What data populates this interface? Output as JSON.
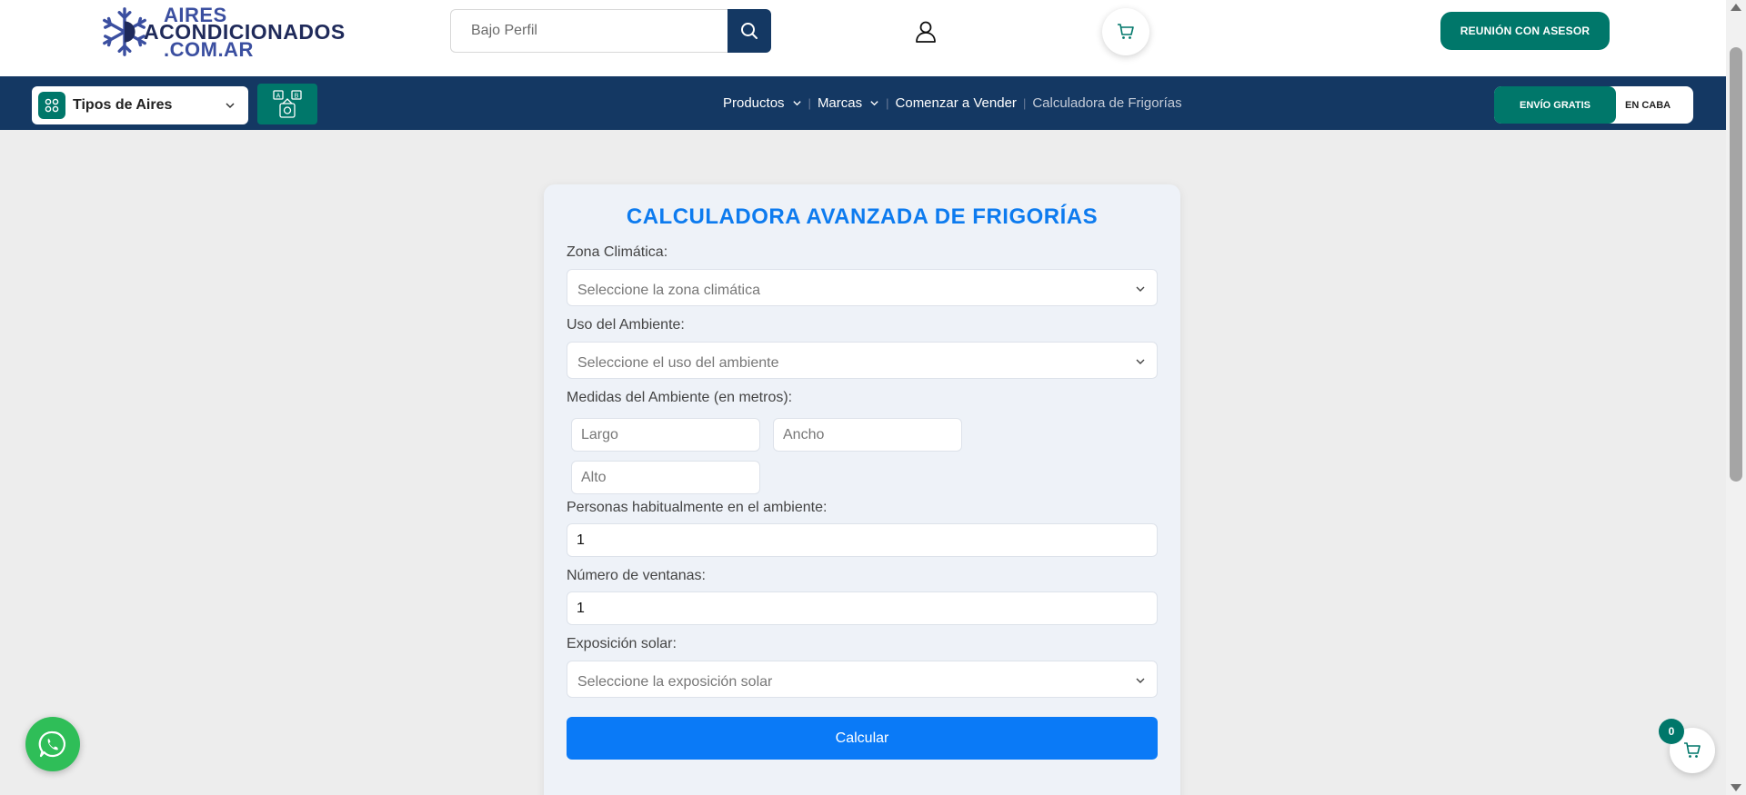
{
  "header": {
    "logo": {
      "line1": "AIRES",
      "line2": "ACONDICIONADOS",
      "line3": ".COM.AR"
    },
    "search": {
      "placeholder": "Bajo Perfil",
      "icon": "search-icon"
    },
    "user_icon": "user-icon",
    "cart_icon": "cart-icon",
    "advisor_label": "REUNIÓN CON ASESOR",
    "accent": "#00776a",
    "brand_dark": "#143863"
  },
  "nav": {
    "types_label": "Tipos de Aires",
    "menu": [
      {
        "label": "Productos",
        "has_chevron": true
      },
      {
        "label": "Marcas",
        "has_chevron": true
      },
      {
        "label": "Comenzar a Vender",
        "has_chevron": false
      },
      {
        "label": "Calculadora de Frigorías",
        "has_chevron": false
      }
    ],
    "ship_a": "ENVÍO GRATIS",
    "ship_b": "EN CABA"
  },
  "calculator": {
    "title": "CALCULADORA AVANZADA DE FRIGORÍAS",
    "zona_label": "Zona Climática:",
    "zona_placeholder": "Seleccione la zona climática",
    "uso_label": "Uso del Ambiente:",
    "uso_placeholder": "Seleccione el uso del ambiente",
    "medidas_label": "Medidas del Ambiente (en metros):",
    "largo_placeholder": "Largo",
    "ancho_placeholder": "Ancho",
    "alto_placeholder": "Alto",
    "personas_label": "Personas habitualmente en el ambiente:",
    "personas_value": "1",
    "ventanas_label": "Número de ventanas:",
    "ventanas_value": "1",
    "exposicion_label": "Exposición solar:",
    "exposicion_placeholder": "Seleccione la exposición solar",
    "button_label": "Calcular",
    "title_color": "#0d7bef",
    "button_color": "#0a7af7"
  },
  "floating": {
    "whatsapp_icon": "whatsapp-icon",
    "cart_count": "0"
  }
}
